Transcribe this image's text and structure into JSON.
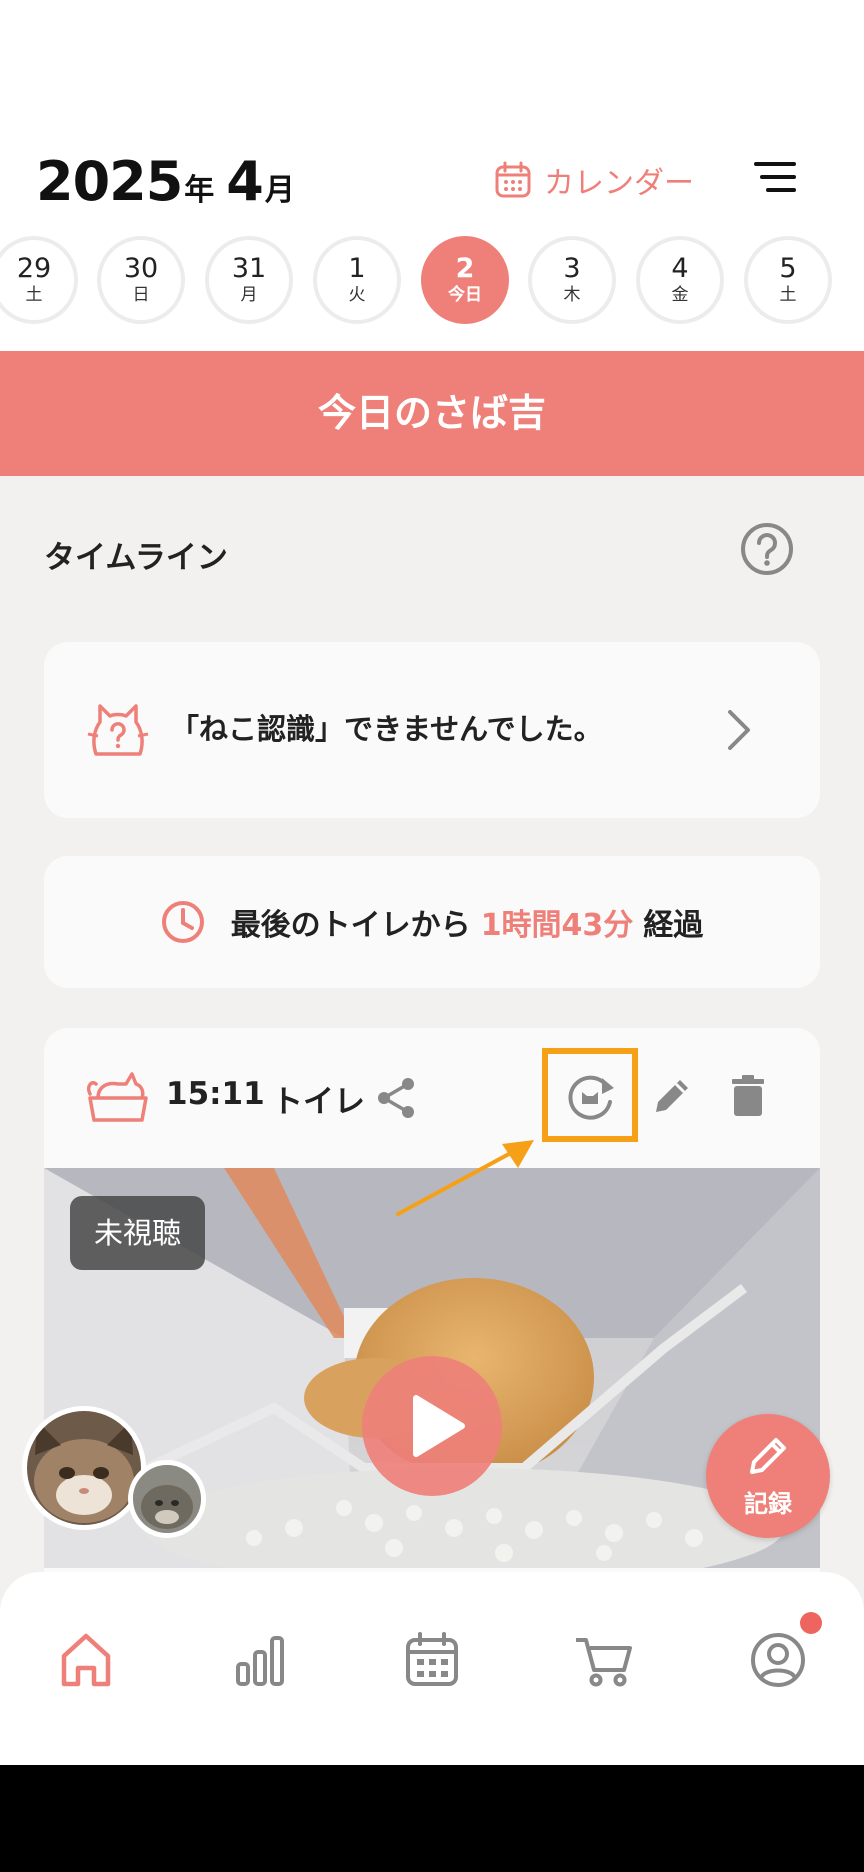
{
  "header": {
    "year": "2025",
    "year_unit": "年",
    "month": "4",
    "month_unit": "月",
    "calendar_label": "カレンダー"
  },
  "dates": [
    {
      "num": "29",
      "dow": "土"
    },
    {
      "num": "30",
      "dow": "日"
    },
    {
      "num": "31",
      "dow": "月"
    },
    {
      "num": "1",
      "dow": "火"
    },
    {
      "num": "2",
      "dow": "今日",
      "selected": true
    },
    {
      "num": "3",
      "dow": "木"
    },
    {
      "num": "4",
      "dow": "金"
    },
    {
      "num": "5",
      "dow": "土"
    }
  ],
  "banner": {
    "title": "今日のさば吉"
  },
  "timeline": {
    "title": "タイムライン",
    "recognition_message": "「ねこ認識」できませんでした。",
    "elapsed": {
      "prefix": "最後のトイレから",
      "value": "1時間43分",
      "suffix": "経過"
    },
    "event": {
      "time": "15:11",
      "type": "トイレ",
      "badge": "未視聴"
    }
  },
  "record_button": {
    "label": "記録"
  },
  "colors": {
    "accent": "#ee8079",
    "highlight_box": "#f5a017",
    "background": "#f2f1ef"
  },
  "icons": [
    "calendar-icon",
    "menu-icon",
    "help-icon",
    "cat-question-icon",
    "chevron-right-icon",
    "clock-icon",
    "cat-toilet-icon",
    "share-icon",
    "cat-reload-icon",
    "pencil-icon",
    "trash-icon",
    "play-icon",
    "home-icon",
    "chart-icon",
    "calendar-nav-icon",
    "cart-icon",
    "profile-icon"
  ]
}
